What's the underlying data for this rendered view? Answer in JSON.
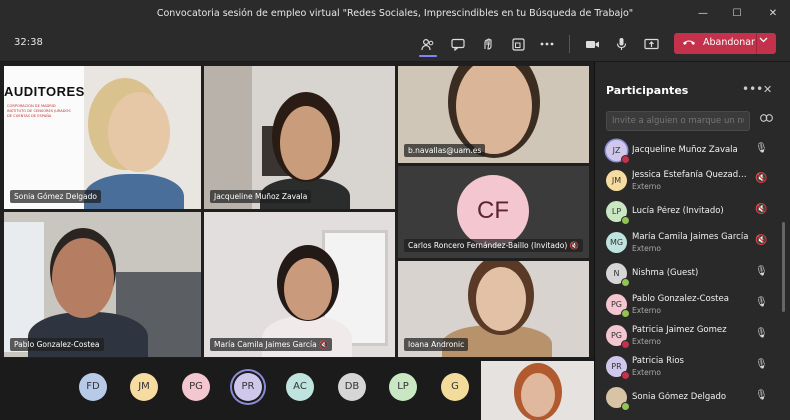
{
  "window": {
    "title": "Convocatoria sesión de empleo virtual \"Redes Sociales, Imprescindibles en tu Búsqueda de Trabajo\"",
    "minimize": "—",
    "maximize": "☐",
    "close": "✕"
  },
  "toolbar": {
    "time": "32:38",
    "leave_label": "Abandonar"
  },
  "tiles": [
    {
      "name": "Sonia Gómez Delgado",
      "logo_title": "AUDITORES",
      "logo_sub1": "CORPORACIÓN DE MADRID",
      "logo_sub2": "INSTITUTO DE CENSORES JURADOS",
      "logo_sub3": "DE CUENTAS DE ESPAÑA"
    },
    {
      "name": "Jacqueline Muñoz Zavala"
    },
    {
      "name": "b.navallas@uam.es"
    },
    {
      "name": "Carlos Roncero Fernández-Baillo (Invitado)",
      "initials": "CF"
    },
    {
      "name": "Pablo Gonzalez-Costea"
    },
    {
      "name": "María Camila Jaimes García"
    },
    {
      "name": "Ioana Andronic"
    }
  ],
  "strip": [
    "FD",
    "JM",
    "PG",
    "PR",
    "AC",
    "DB",
    "LP",
    "G"
  ],
  "colors": {
    "accent": "#7f85f5",
    "leave": "#c4314b",
    "avatar_blue": "#b7cbe8",
    "avatar_yellow": "#f6dca1",
    "avatar_pink": "#f4c6cf",
    "avatar_purple": "#cfc8ec",
    "avatar_teal": "#bfe3de",
    "avatar_gray": "#d6d6d6",
    "avatar_green": "#c9e7c3",
    "avatar_gold": "#f3dc9b"
  },
  "panel": {
    "title": "Participantes",
    "invite_placeholder": "Invite a alguien o marque un número",
    "participants": [
      {
        "initials": "JZ",
        "name": "Jacqueline Muñoz Zavala",
        "sub": "",
        "mic": "🎙"
      },
      {
        "initials": "JM",
        "name": "Jessica Estefanía Quezada Moreno",
        "sub": "Externo",
        "mic": "🔇"
      },
      {
        "initials": "LP",
        "name": "Lucía Pérez (Invitado)",
        "sub": "",
        "mic": "🔇"
      },
      {
        "initials": "MG",
        "name": "María Camila Jaimes García",
        "sub": "Externo",
        "mic": "🔇"
      },
      {
        "initials": "N",
        "name": "Nishma (Guest)",
        "sub": "",
        "mic": "🎙"
      },
      {
        "initials": "PG",
        "name": "Pablo Gonzalez-Costea",
        "sub": "Externo",
        "mic": "🎙"
      },
      {
        "initials": "PG",
        "name": "Patricia Jaimez Gomez",
        "sub": "Externo",
        "mic": "🎙"
      },
      {
        "initials": "PR",
        "name": "Patricia Rios",
        "sub": "Externo",
        "mic": "🎙"
      },
      {
        "initials": "",
        "name": "Sonia Gómez Delgado",
        "sub": "",
        "mic": "🎙"
      }
    ]
  }
}
